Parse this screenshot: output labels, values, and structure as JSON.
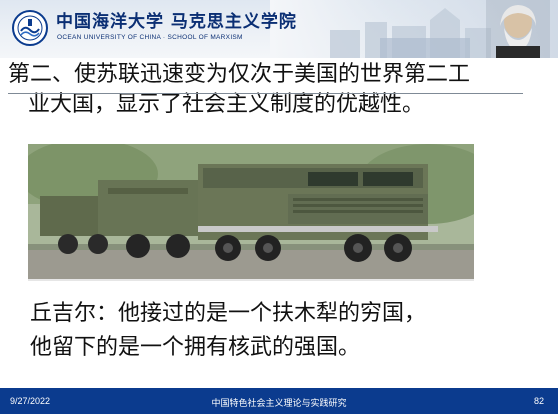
{
  "header": {
    "university_cn": "中国海洋大学 马克思主义学院",
    "university_en": "OCEAN UNIVERSITY OF CHINA · SCHOOL OF MARXISM",
    "logo_icon": "university-seal-icon",
    "portrait_icon": "portrait-icon"
  },
  "slide": {
    "title_line1": "第二、使苏联迅速变为仅次于美国的世界第二工",
    "title_line2": "业大国，显示了社会主义制度的优越性。",
    "quote_line1": "丘吉尔：他接过的是一个扶木犁的穷国，",
    "quote_line2": "他留下的是一个拥有核武的强国。"
  },
  "footer": {
    "date": "9/27/2022",
    "course": "中国特色社会主义理论与实践研究",
    "page": "82"
  },
  "colors": {
    "footer_bg": "#0b3b8e",
    "brand_blue": "#0b2f74"
  },
  "chart_data": {
    "type": "table",
    "title": "",
    "rows": []
  }
}
